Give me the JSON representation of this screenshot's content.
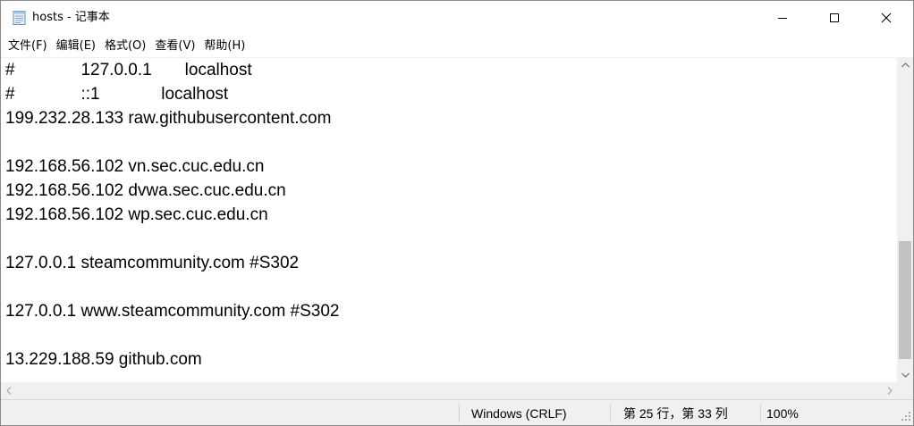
{
  "window": {
    "title": "hosts - 记事本",
    "controls": {
      "minimize_icon": "minimize-icon",
      "maximize_icon": "maximize-icon",
      "close_icon": "close-icon"
    }
  },
  "menu": [
    {
      "label": "文件(F)"
    },
    {
      "label": "编辑(E)"
    },
    {
      "label": "格式(O)"
    },
    {
      "label": "查看(V)"
    },
    {
      "label": "帮助(H)"
    }
  ],
  "editor": {
    "lines": [
      "#              127.0.0.1       localhost",
      "#              ::1             localhost",
      "199.232.28.133 raw.githubusercontent.com",
      "",
      "192.168.56.102 vn.sec.cuc.edu.cn",
      "192.168.56.102 dvwa.sec.cuc.edu.cn",
      "192.168.56.102 wp.sec.cuc.edu.cn",
      "",
      "127.0.0.1 steamcommunity.com #S302",
      "",
      "127.0.0.1 www.steamcommunity.com #S302",
      "",
      "13.229.188.59 github.com"
    ]
  },
  "status": {
    "line_ending": "Windows (CRLF)",
    "position": "第 25 行，第 33 列",
    "zoom": "100%"
  },
  "colors": {
    "chrome": "#f0f0f0",
    "scroll_thumb": "#c2c2c2",
    "text": "#000000"
  }
}
